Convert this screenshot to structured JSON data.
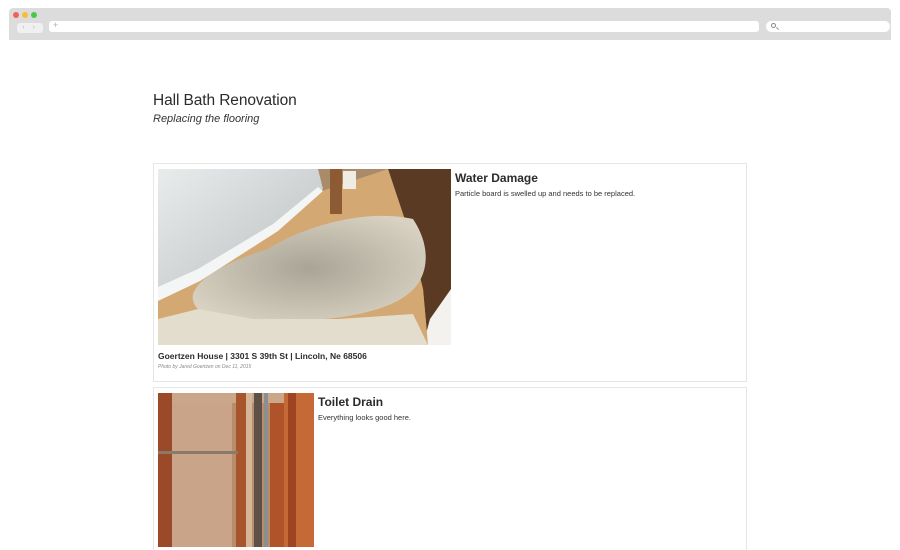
{
  "browser": {
    "nav_arrows": "‹ ›",
    "address_plus": "+"
  },
  "page": {
    "title": "Hall Bath Renovation",
    "subtitle": "Replacing the flooring"
  },
  "entries": [
    {
      "title": "Water Damage",
      "text": "Particle board is swelled up and needs to be replaced.",
      "location": "Goertzen House | 3301 S 39th St | Lincoln, Ne 68506",
      "credit": "Photo by Jared Goertzen on Dec 11, 2015"
    },
    {
      "title": "Toilet Drain",
      "text": "Everything looks good here."
    }
  ]
}
